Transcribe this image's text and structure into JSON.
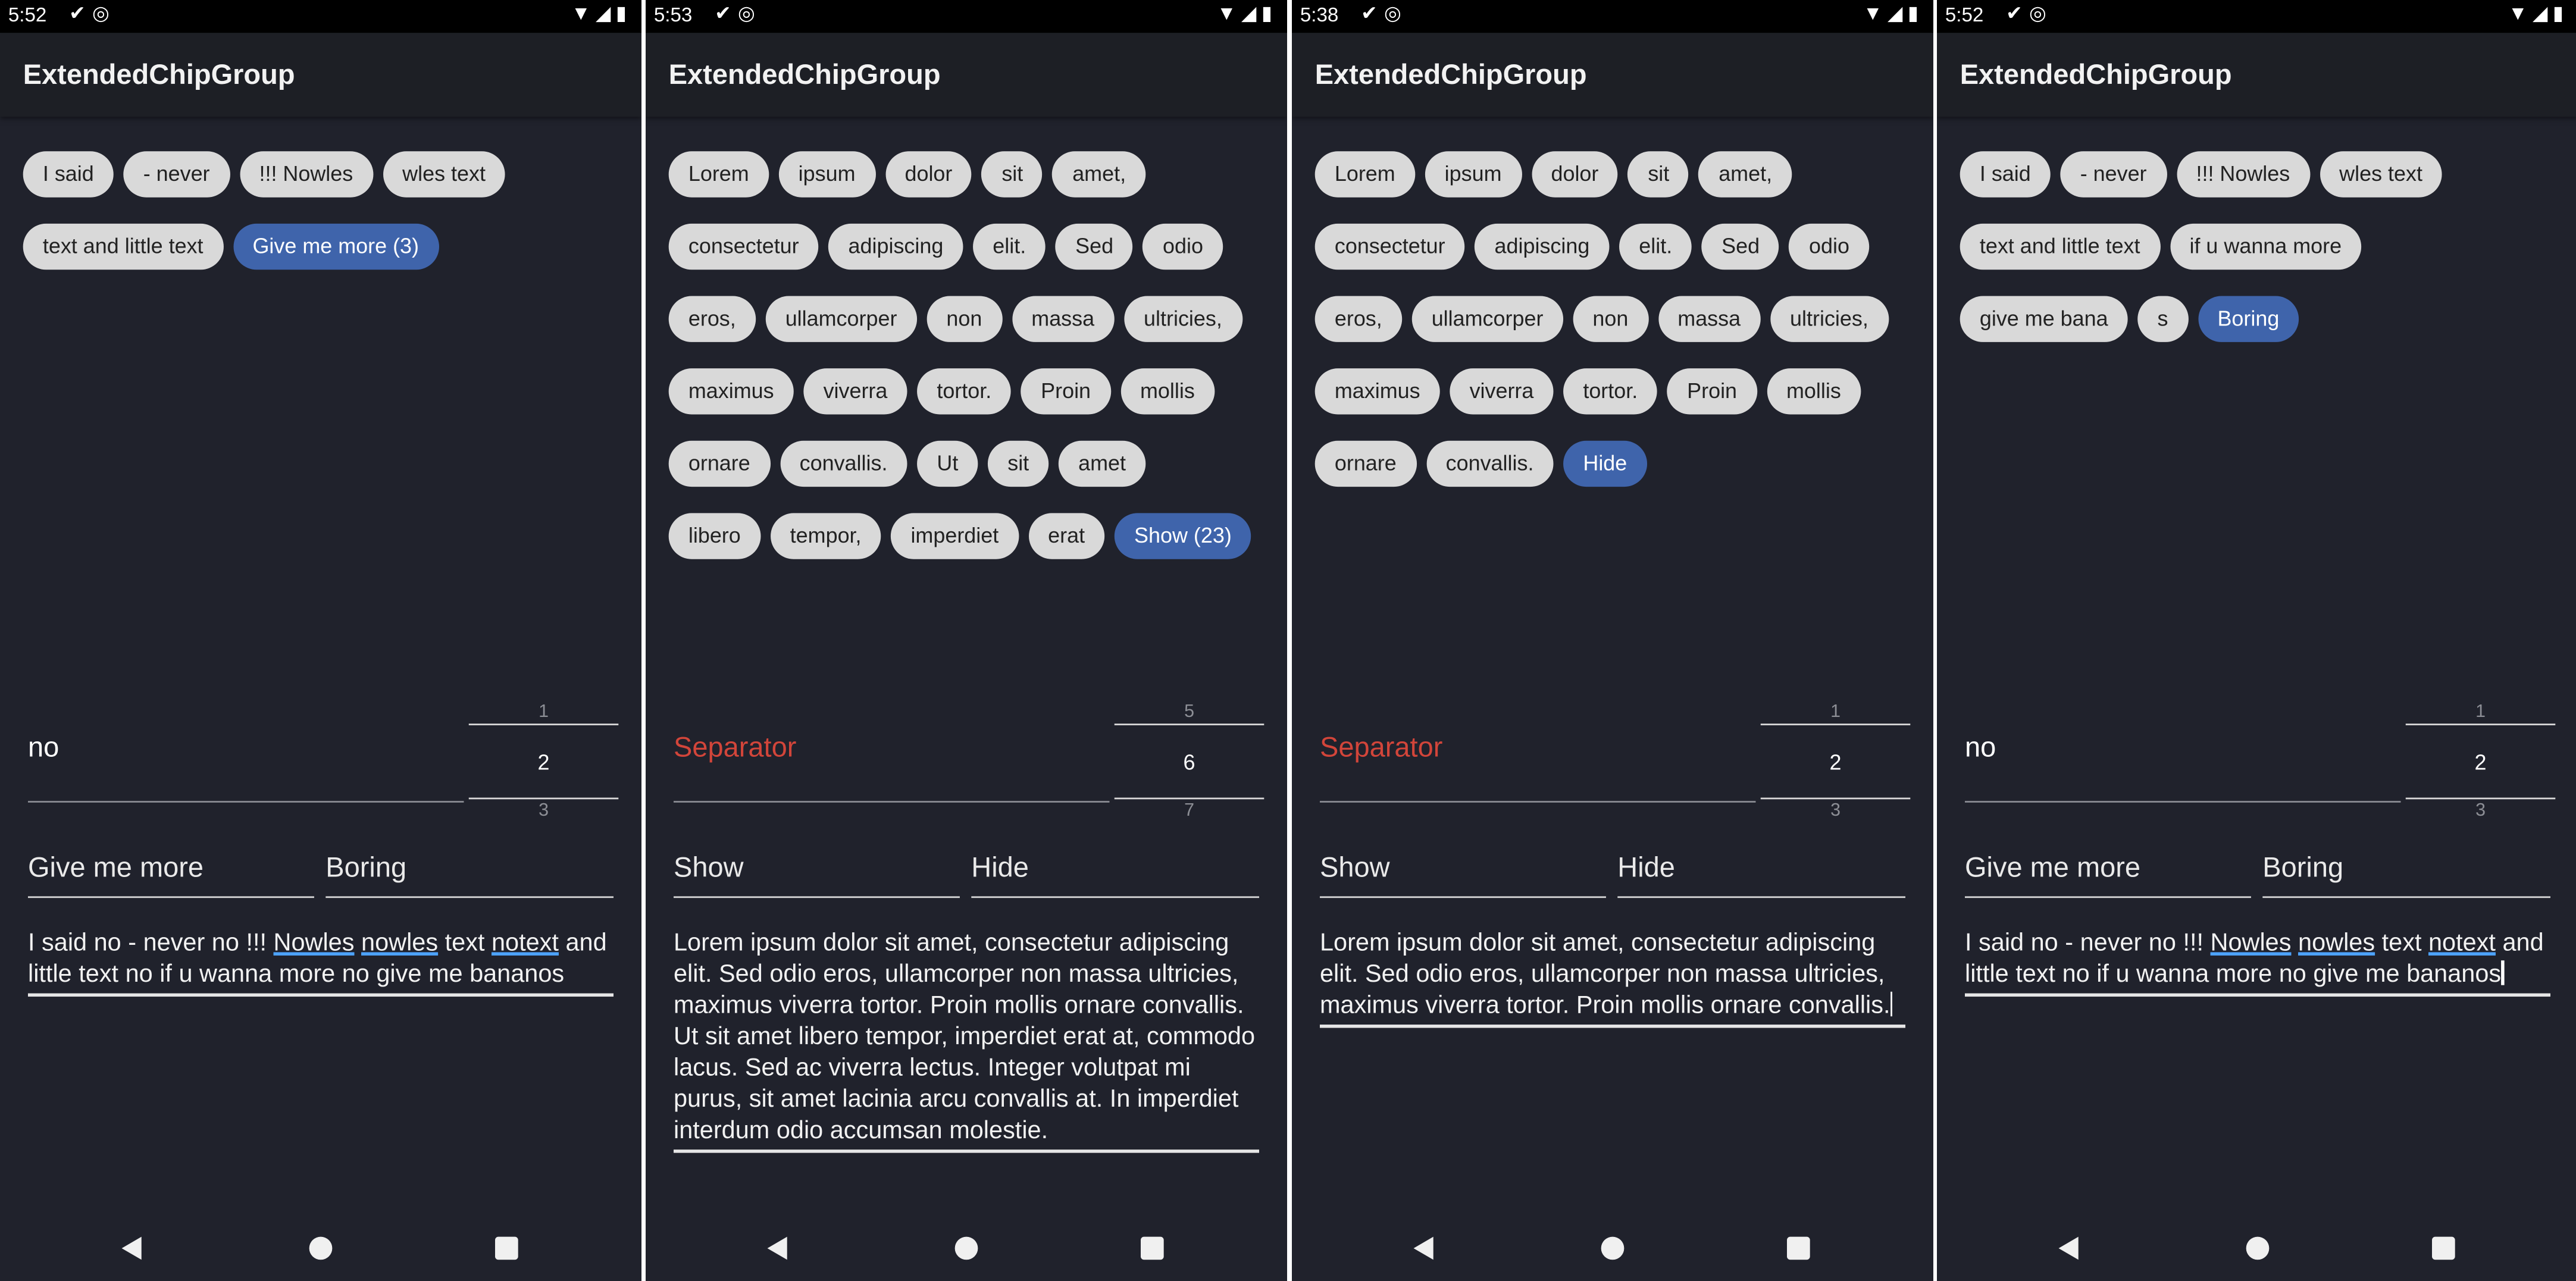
{
  "screens": [
    {
      "status_time": "5:52",
      "app_title": "ExtendedChipGroup",
      "chip_rows": [
        [
          {
            "label": "I said"
          },
          {
            "label": "- never"
          },
          {
            "label": "!!! Nowles"
          },
          {
            "label": "wles text"
          }
        ],
        [
          {
            "label": "text and little text"
          },
          {
            "label": "Give me more (3)",
            "active": true
          }
        ]
      ],
      "separator_text": "no",
      "separator_is_error": false,
      "picker": {
        "prev": "1",
        "current": "2",
        "next": "3"
      },
      "more_label": "Give me more",
      "less_label": "Boring",
      "result_segments": [
        {
          "t": "I said no - never no !!! "
        },
        {
          "t": "Nowles",
          "u": true
        },
        {
          "t": " "
        },
        {
          "t": "nowles",
          "u": true
        },
        {
          "t": " text "
        },
        {
          "t": "notext",
          "u": true
        },
        {
          "t": " and little text no if u wanna more no give me bananos"
        }
      ],
      "show_cursor": false
    },
    {
      "status_time": "5:53",
      "app_title": "ExtendedChipGroup",
      "chip_rows": [
        [
          {
            "label": "Lorem"
          },
          {
            "label": "ipsum"
          },
          {
            "label": "dolor"
          },
          {
            "label": "sit"
          },
          {
            "label": "amet,"
          }
        ],
        [
          {
            "label": "consectetur"
          },
          {
            "label": "adipiscing"
          },
          {
            "label": "elit."
          },
          {
            "label": "Sed"
          },
          {
            "label": "odio"
          }
        ],
        [
          {
            "label": "eros,"
          },
          {
            "label": "ullamcorper"
          },
          {
            "label": "non"
          },
          {
            "label": "massa"
          },
          {
            "label": "ultricies,"
          }
        ],
        [
          {
            "label": "maximus"
          },
          {
            "label": "viverra"
          },
          {
            "label": "tortor."
          },
          {
            "label": "Proin"
          },
          {
            "label": "mollis"
          }
        ],
        [
          {
            "label": "ornare"
          },
          {
            "label": "convallis."
          },
          {
            "label": "Ut"
          },
          {
            "label": "sit"
          },
          {
            "label": "amet"
          }
        ],
        [
          {
            "label": "libero"
          },
          {
            "label": "tempor,"
          },
          {
            "label": "imperdiet"
          },
          {
            "label": "erat"
          },
          {
            "label": "Show (23)",
            "active": true
          }
        ]
      ],
      "separator_text": "Separator",
      "separator_is_error": true,
      "picker": {
        "prev": "5",
        "current": "6",
        "next": "7"
      },
      "more_label": "Show",
      "less_label": "Hide",
      "result_segments": [
        {
          "t": "Lorem ipsum dolor sit amet, consectetur adipiscing elit. Sed odio eros, ullamcorper non massa ultricies, maximus viverra tortor. Proin mollis ornare convallis. Ut sit amet libero tempor, imperdiet erat at, commodo lacus. Sed ac viverra lectus. Integer volutpat mi purus, sit amet lacinia arcu convallis at. In imperdiet interdum odio accumsan molestie."
        }
      ],
      "show_cursor": false
    },
    {
      "status_time": "5:38",
      "app_title": "ExtendedChipGroup",
      "chip_rows": [
        [
          {
            "label": "Lorem"
          },
          {
            "label": "ipsum"
          },
          {
            "label": "dolor"
          },
          {
            "label": "sit"
          },
          {
            "label": "amet,"
          }
        ],
        [
          {
            "label": "consectetur"
          },
          {
            "label": "adipiscing"
          },
          {
            "label": "elit."
          },
          {
            "label": "Sed"
          },
          {
            "label": "odio"
          }
        ],
        [
          {
            "label": "eros,"
          },
          {
            "label": "ullamcorper"
          },
          {
            "label": "non"
          },
          {
            "label": "massa"
          },
          {
            "label": "ultricies,"
          }
        ],
        [
          {
            "label": "maximus"
          },
          {
            "label": "viverra"
          },
          {
            "label": "tortor."
          },
          {
            "label": "Proin"
          },
          {
            "label": "mollis"
          }
        ],
        [
          {
            "label": "ornare"
          },
          {
            "label": "convallis."
          },
          {
            "label": "Hide",
            "active": true
          }
        ]
      ],
      "separator_text": "Separator",
      "separator_is_error": true,
      "picker": {
        "prev": "1",
        "current": "2",
        "next": "3"
      },
      "more_label": "Show",
      "less_label": "Hide",
      "result_segments": [
        {
          "t": "Lorem ipsum dolor sit amet, consectetur adipiscing elit. Sed odio eros, ullamcorper non massa ultricies, maximus viverra tortor. Proin mollis ornare convallis."
        }
      ],
      "show_cursor": true
    },
    {
      "status_time": "5:52",
      "app_title": "ExtendedChipGroup",
      "chip_rows": [
        [
          {
            "label": "I said"
          },
          {
            "label": "- never"
          },
          {
            "label": "!!! Nowles"
          },
          {
            "label": "wles text"
          }
        ],
        [
          {
            "label": "text and little text"
          },
          {
            "label": "if u wanna more"
          }
        ],
        [
          {
            "label": "give me bana"
          },
          {
            "label": "s"
          },
          {
            "label": "Boring",
            "active": true
          }
        ]
      ],
      "separator_text": "no",
      "separator_is_error": false,
      "picker": {
        "prev": "1",
        "current": "2",
        "next": "3"
      },
      "more_label": "Give me more",
      "less_label": "Boring",
      "result_segments": [
        {
          "t": "I said no - never no !!! "
        },
        {
          "t": "Nowles",
          "u": true
        },
        {
          "t": " "
        },
        {
          "t": "nowles",
          "u": true
        },
        {
          "t": " text "
        },
        {
          "t": "notext",
          "u": true
        },
        {
          "t": " and little text no if u wanna more no give me bananos"
        }
      ],
      "show_cursor": true
    }
  ],
  "colors": {
    "background": "#20222c",
    "appbar": "#1d1f25",
    "chip": "#d9d9d9",
    "chip_active": "#3f64ab",
    "error": "#d2453a",
    "underline_accent": "#4da3ff"
  },
  "icons": {
    "status_left": [
      "check-icon",
      "sync-icon"
    ],
    "status_right": [
      "wifi-icon",
      "signal-icon",
      "battery-icon"
    ],
    "nav": [
      "back-icon",
      "home-icon",
      "recents-icon"
    ]
  }
}
